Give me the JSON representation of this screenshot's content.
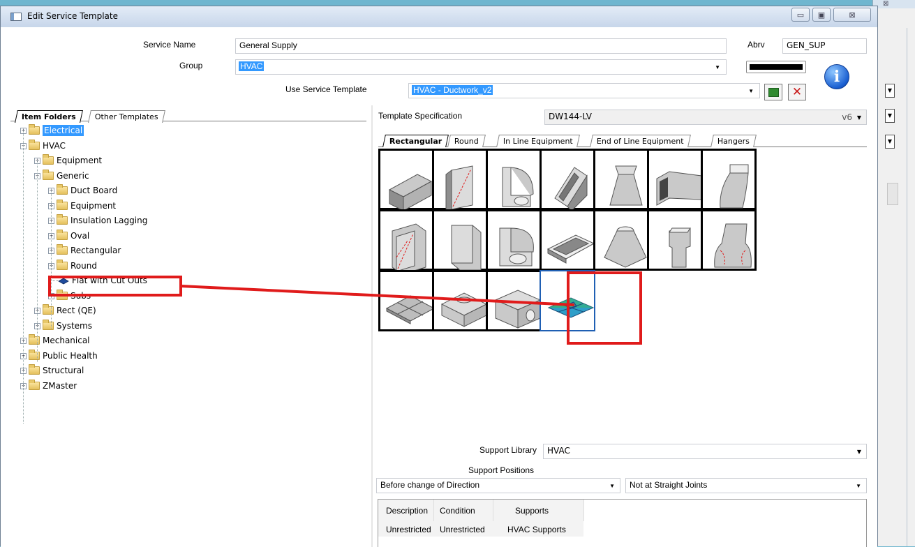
{
  "window": {
    "title": "Edit Service Template"
  },
  "caption_buttons": {
    "minimize": "▭",
    "restore": "▣",
    "close": "⊠"
  },
  "form": {
    "service_name_label": "Service Name",
    "service_name_value": "General Supply",
    "abrv_label": "Abrv",
    "abrv_value": "GEN_SUP",
    "group_label": "Group",
    "group_value": "HVAC",
    "use_template_label": "Use Service Template",
    "use_template_value": "HVAC - Ductwork_v2",
    "dropdown_arrow": "▼",
    "delete_glyph": "✕",
    "info_glyph": "i",
    "color_swatch": "#000000"
  },
  "left_tabs": {
    "item_folders": "Item Folders",
    "other_templates": "Other Templates"
  },
  "tree": [
    {
      "label": "Electrical",
      "level": 0,
      "expander": "+",
      "selected": true
    },
    {
      "label": "HVAC",
      "level": 0,
      "expander": "−"
    },
    {
      "label": "Equipment",
      "level": 1,
      "expander": "+"
    },
    {
      "label": "Generic",
      "level": 1,
      "expander": "−"
    },
    {
      "label": "Duct Board",
      "level": 2,
      "expander": "+"
    },
    {
      "label": "Equipment",
      "level": 2,
      "expander": "+"
    },
    {
      "label": "Insulation Lagging",
      "level": 2,
      "expander": "+"
    },
    {
      "label": "Oval",
      "level": 2,
      "expander": "+"
    },
    {
      "label": "Rectangular",
      "level": 2,
      "expander": "+"
    },
    {
      "label": "Round",
      "level": 2,
      "expander": "+"
    },
    {
      "label": "Flat with Cut Outs",
      "level": 2,
      "expander": "",
      "item": true
    },
    {
      "label": "Subs",
      "level": 2,
      "expander": "+"
    },
    {
      "label": "Rect (QE)",
      "level": 1,
      "expander": "+"
    },
    {
      "label": "Systems",
      "level": 1,
      "expander": "+"
    },
    {
      "label": "Mechanical",
      "level": 0,
      "expander": "+"
    },
    {
      "label": "Public Health",
      "level": 0,
      "expander": "+"
    },
    {
      "label": "Structural",
      "level": 0,
      "expander": "+"
    },
    {
      "label": "ZMaster",
      "level": 0,
      "expander": "+"
    }
  ],
  "template_spec": {
    "label": "Template Specification",
    "value": "DW144-LV",
    "version": "v6"
  },
  "right_tabs": [
    "Rectangular",
    "Round",
    "In Line Equipment",
    "End of Line Equipment",
    "Hangers"
  ],
  "fittings": [
    {
      "name": "straight-duct-fitting-icon"
    },
    {
      "name": "splitter-fitting-icon"
    },
    {
      "name": "radius-bend-fitting-icon"
    },
    {
      "name": "offset-fitting-icon"
    },
    {
      "name": "taper-fitting-icon"
    },
    {
      "name": "square-bend-fitting-icon"
    },
    {
      "name": "shoe-fitting-icon"
    },
    {
      "name": "vane-bend-fitting-icon"
    },
    {
      "name": "mitre-bend-fitting-icon"
    },
    {
      "name": "radius-elbow-fitting-icon"
    },
    {
      "name": "flange-frame-fitting-icon"
    },
    {
      "name": "round-to-square-fitting-icon"
    },
    {
      "name": "tee-fitting-icon"
    },
    {
      "name": "breeches-fitting-icon"
    },
    {
      "name": "plenum-fitting-icon"
    },
    {
      "name": "spigot-box-fitting-icon"
    },
    {
      "name": "side-spigot-box-fitting-icon"
    },
    {
      "name": "flat-with-cut-outs-fitting-icon",
      "selected": true
    }
  ],
  "support": {
    "library_label": "Support Library",
    "library_value": "HVAC",
    "positions_label": "Support Positions",
    "position_1": "Before change of Direction",
    "position_2": "Not at Straight Joints"
  },
  "support_table": {
    "headers": [
      "Description",
      "Condition",
      "Supports"
    ],
    "rows": [
      [
        "Unrestricted",
        "Unrestricted",
        "HVAC Supports"
      ]
    ]
  },
  "annotation_color": "#e01b1b"
}
